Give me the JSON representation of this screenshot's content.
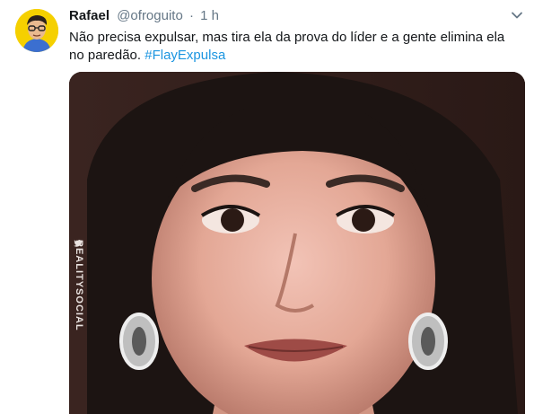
{
  "tweet": {
    "author_name": "Rafael",
    "author_handle": "@ofroguito",
    "separator": "·",
    "timestamp": "1 h",
    "text": "Não precisa expulsar, mas tira ela da prova do líder e a gente elimina ela no paredão.",
    "hashtag": "#FlayExpulsa",
    "menu_icon": "chevron-down-icon",
    "media_watermark": "REALITYSOCIAL"
  },
  "colors": {
    "hashtag": "#1b95e0",
    "secondary_text": "#657786",
    "primary_text": "#14171a",
    "avatar_bg": "#f5d000"
  }
}
